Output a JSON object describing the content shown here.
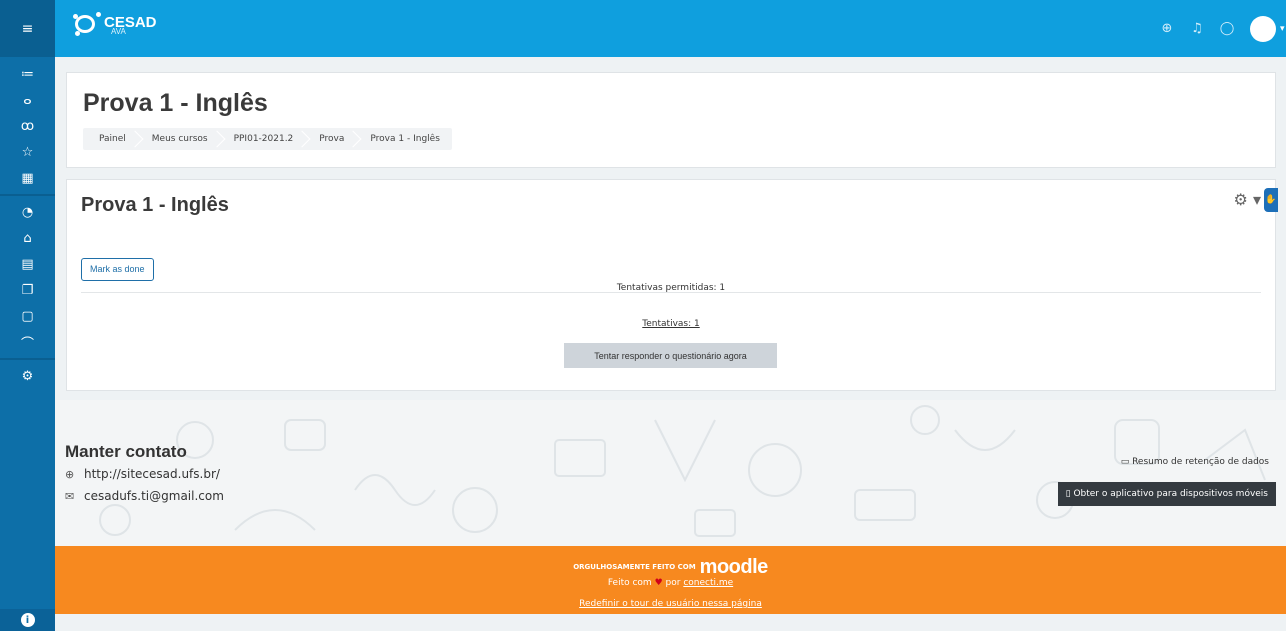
{
  "rail": {
    "top_icon": "menu-icon",
    "items": [
      {
        "name": "list-icon",
        "glyph": "≔"
      },
      {
        "name": "participants-icon",
        "glyph": "ℬ"
      },
      {
        "name": "badges-icon",
        "glyph": "ℛ"
      },
      {
        "name": "star-icon",
        "glyph": "☆"
      },
      {
        "name": "grades-icon",
        "glyph": "▦"
      }
    ],
    "items2": [
      {
        "name": "dashboard-icon",
        "glyph": "◔"
      },
      {
        "name": "home-icon",
        "glyph": "⌂"
      },
      {
        "name": "calendar-icon",
        "glyph": "▤"
      },
      {
        "name": "files-icon",
        "glyph": "❐"
      },
      {
        "name": "courses-icon",
        "glyph": "◻"
      },
      {
        "name": "graduation-icon",
        "glyph": "⌒"
      }
    ],
    "items3": [
      {
        "name": "settings-icon",
        "glyph": "⚙"
      }
    ],
    "bottom_icon": "accessibility-icon"
  },
  "navbar": {
    "logo_name": "CESAD",
    "logo_sub": "AVA",
    "icons": [
      "language-icon",
      "notifications-icon",
      "messages-icon"
    ],
    "brand_color": "#0f9fde"
  },
  "header": {
    "title": "Prova 1 - Inglês",
    "breadcrumbs": [
      "Painel",
      "Meus cursos",
      "PPI01-2021.2",
      "Prova",
      "Prova 1 - Inglês"
    ]
  },
  "activity": {
    "title": "Prova 1 - Inglês",
    "mark_done_label": "Mark as done",
    "attempts_allowed": "Tentativas permitidas: 1",
    "attempts_link": "Tentativas: 1",
    "try_button": "Tentar responder o questionário agora"
  },
  "footer": {
    "contact_title": "Manter contato",
    "site_url": "http://sitecesad.ufs.br/",
    "email": "cesadufs.ti@gmail.com",
    "retention_label": "Resumo de retenção de dados",
    "app_button": "Obter o aplicativo para dispositivos móveis"
  },
  "footer_bottom": {
    "made_with_prefix": "ORGULHOSAMENTE FEITO COM",
    "moodle_logo_text": "moodle",
    "made_by_prefix": "Feito com",
    "made_by_mid": "por",
    "made_by_link": "conecti.me",
    "reset_tour": "Redefinir o tour de usuário nessa página",
    "bar_color": "#f7891f"
  }
}
